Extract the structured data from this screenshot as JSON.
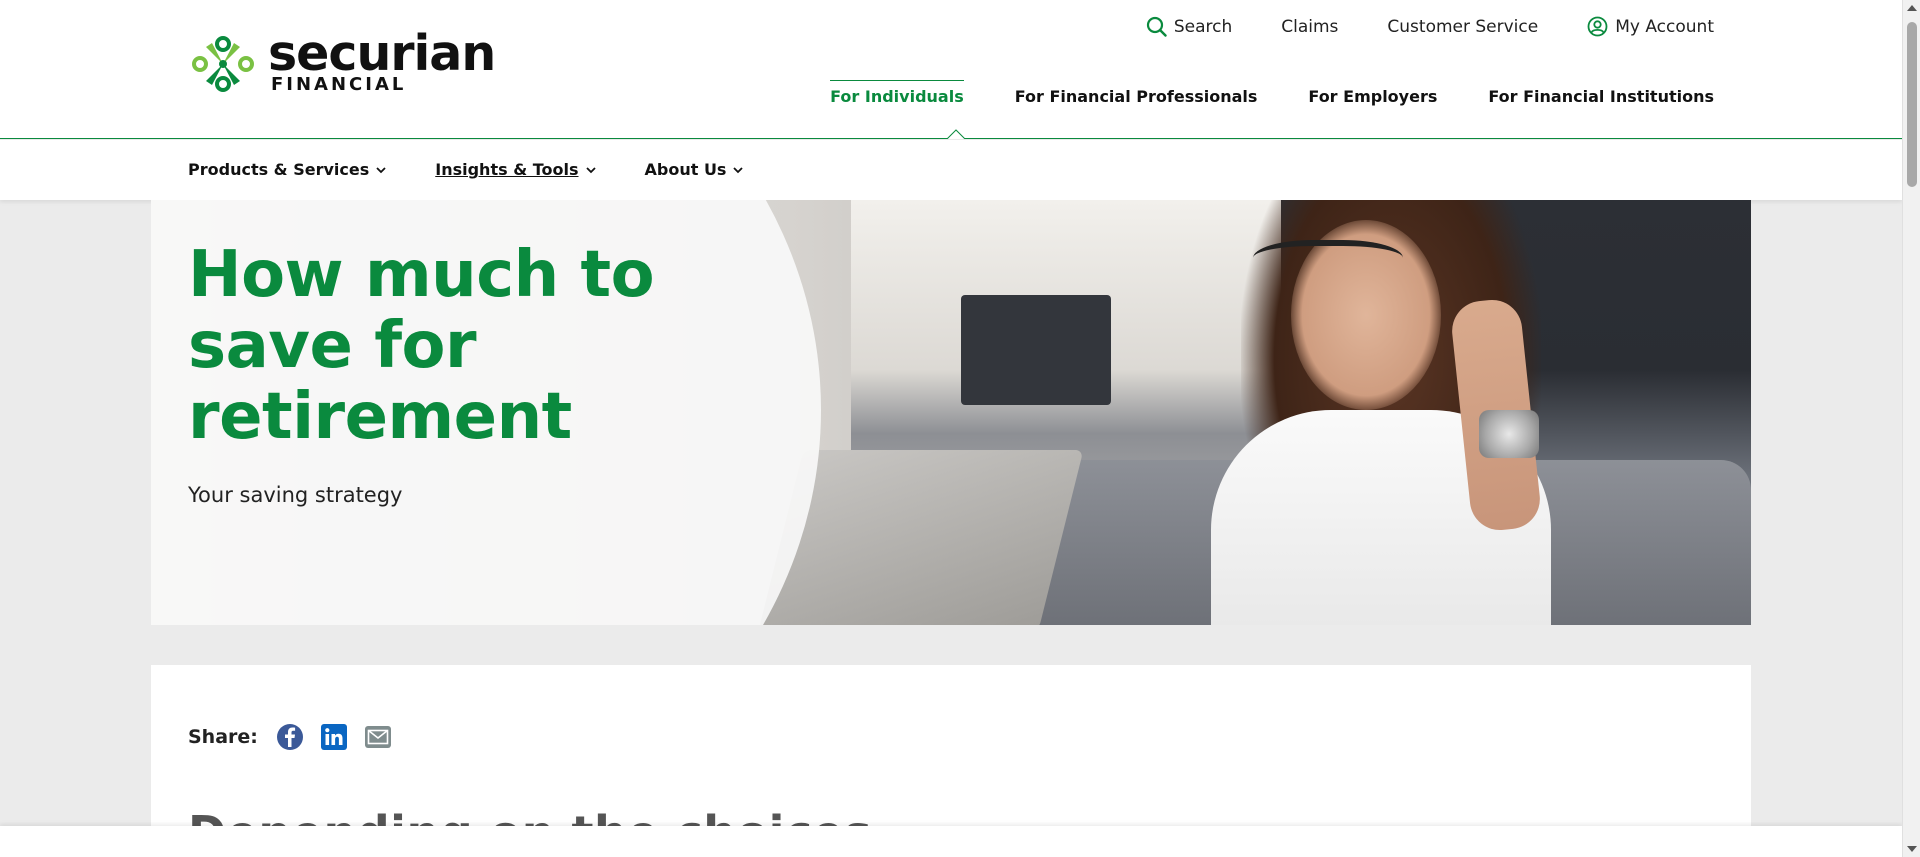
{
  "brand": {
    "name": "securian",
    "sub": "FINANCIAL",
    "green": "#0a8a3e"
  },
  "utility_nav": {
    "search": "Search",
    "claims": "Claims",
    "customer_service": "Customer Service",
    "my_account": "My Account"
  },
  "audience_nav": {
    "items": [
      {
        "label": "For Individuals",
        "active": true
      },
      {
        "label": "For Financial Professionals",
        "active": false
      },
      {
        "label": "For Employers",
        "active": false
      },
      {
        "label": "For Financial Institutions",
        "active": false
      }
    ]
  },
  "sub_nav": {
    "items": [
      {
        "label": "Products & Services"
      },
      {
        "label": "Insights & Tools"
      },
      {
        "label": "About Us"
      }
    ]
  },
  "hero": {
    "title": "How much to save for retirement",
    "subtitle": "Your saving strategy"
  },
  "share": {
    "label": "Share:",
    "icons": [
      "facebook-icon",
      "linkedin-icon",
      "email-icon"
    ]
  },
  "content": {
    "partial_heading": "Depending on the choices"
  }
}
